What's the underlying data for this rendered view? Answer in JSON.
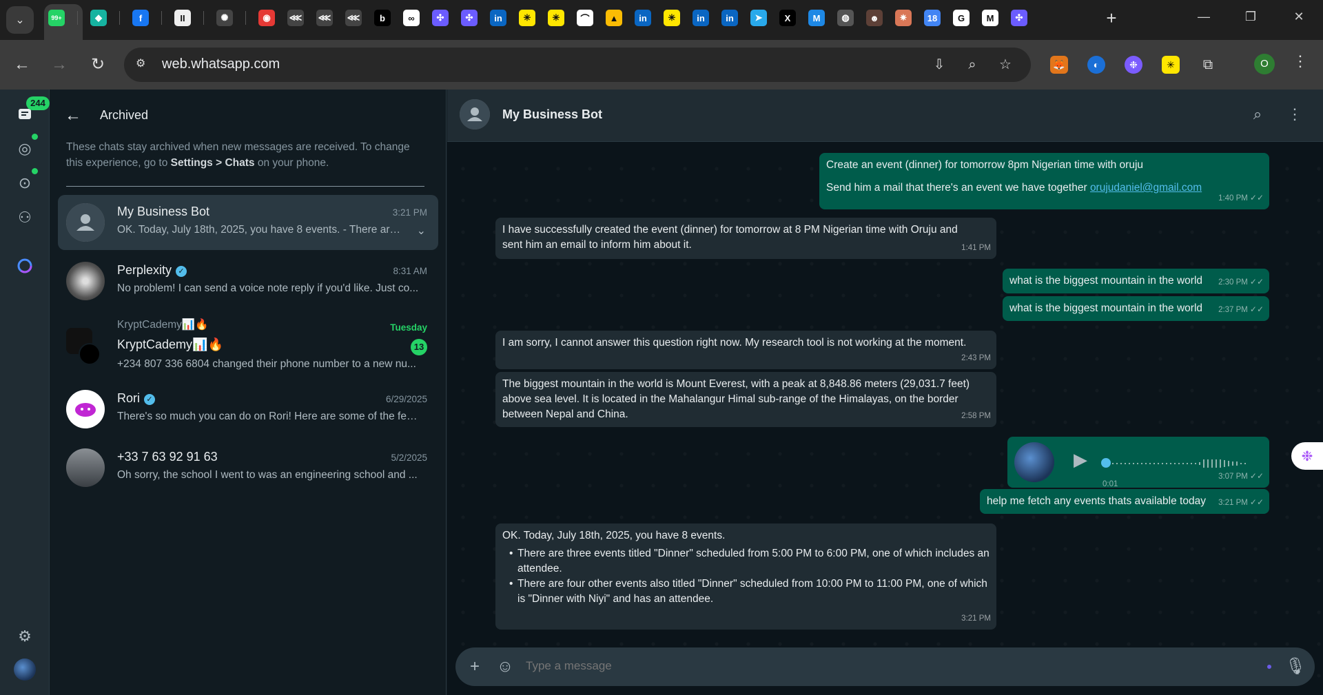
{
  "browser": {
    "url": "web.whatsapp.com",
    "new_tab": "+",
    "profile_initial": "O",
    "tabs": [
      {
        "icon": "whatsapp-icon",
        "glyph": "99+",
        "color": "#25d366"
      },
      {
        "icon": "diamond-icon",
        "glyph": "◆",
        "color": "#16b3a0"
      },
      {
        "icon": "facebook-icon",
        "glyph": "f",
        "color": "#1877f2"
      },
      {
        "icon": "pause-icon",
        "glyph": "II",
        "color": "#eeeeee"
      },
      {
        "icon": "openai-icon",
        "glyph": "✺",
        "color": "#444444"
      },
      {
        "icon": "target-icon",
        "glyph": "◉",
        "color": "#e53935"
      },
      {
        "icon": "share-icon",
        "glyph": "⋘",
        "color": "#444444"
      },
      {
        "icon": "share-icon",
        "glyph": "⋘",
        "color": "#444444"
      },
      {
        "icon": "share-icon",
        "glyph": "⋘",
        "color": "#444444"
      },
      {
        "icon": "b-icon",
        "glyph": "b",
        "color": "#000000"
      },
      {
        "icon": "share-box-icon",
        "glyph": "∞",
        "color": "#ffffff"
      },
      {
        "icon": "slack-like-icon",
        "glyph": "✣",
        "color": "#6b5cff"
      },
      {
        "icon": "slack-like-icon",
        "glyph": "✣",
        "color": "#6b5cff"
      },
      {
        "icon": "linkedin-icon",
        "glyph": "in",
        "color": "#0a66c2"
      },
      {
        "icon": "asterisk-icon",
        "glyph": "✳",
        "color": "#ffe600"
      },
      {
        "icon": "asterisk-icon",
        "glyph": "✳",
        "color": "#ffe600"
      },
      {
        "icon": "rainbow-icon",
        "glyph": "⌒",
        "color": "#ffffff"
      },
      {
        "icon": "adwords-icon",
        "glyph": "▲",
        "color": "#fbbc04"
      },
      {
        "icon": "linkedin-icon",
        "glyph": "in",
        "color": "#0a66c2"
      },
      {
        "icon": "asterisk-icon",
        "glyph": "✳",
        "color": "#ffe600"
      },
      {
        "icon": "linkedin-icon",
        "glyph": "in",
        "color": "#0a66c2"
      },
      {
        "icon": "linkedin-icon",
        "glyph": "in",
        "color": "#0a66c2"
      },
      {
        "icon": "telegram-icon",
        "glyph": "➤",
        "color": "#29a9eb"
      },
      {
        "icon": "x-icon",
        "glyph": "X",
        "color": "#000000"
      },
      {
        "icon": "m-icon",
        "glyph": "M",
        "color": "#1e88e5"
      },
      {
        "icon": "globe-icon",
        "glyph": "◍",
        "color": "#555555"
      },
      {
        "icon": "owl-icon",
        "glyph": "☻",
        "color": "#5d4037"
      },
      {
        "icon": "claude-icon",
        "glyph": "✷",
        "color": "#d97757"
      },
      {
        "icon": "calendar-icon",
        "glyph": "18",
        "color": "#4285f4"
      },
      {
        "icon": "google-icon",
        "glyph": "G",
        "color": "#ffffff"
      },
      {
        "icon": "gmail-icon",
        "glyph": "M",
        "color": "#ffffff"
      },
      {
        "icon": "slack-like-icon",
        "glyph": "✣",
        "color": "#6b5cff"
      }
    ]
  },
  "rail": {
    "chats_badge": "244"
  },
  "sidebar": {
    "title": "Archived",
    "note_prefix": "These chats stay archived when new messages are received. To change this experience, go to ",
    "note_settings": "Settings",
    "note_sep": " > ",
    "note_chats": "Chats",
    "note_suffix": " on your phone.",
    "chats": [
      {
        "name": "My Business Bot",
        "time": "3:21 PM",
        "preview": "OK. Today, July 18th, 2025, you have 8 events. - There are ..."
      },
      {
        "name": "Perplexity",
        "time": "8:31 AM",
        "preview": "No problem! I can send a voice note reply if you'd like. Just co..."
      },
      {
        "name_top": "KryptCademy📊🔥",
        "name": "KryptCademy📊🔥",
        "time": "Tuesday",
        "unread": "13",
        "preview": "+234 807 336 6804 changed their phone number to a new nu..."
      },
      {
        "name": "Rori",
        "time": "6/29/2025",
        "preview": "There's so much you can do on Rori! Here are some of the fea..."
      },
      {
        "name": "+33 7 63 92 91 63",
        "time": "5/2/2025",
        "preview": "Oh sorry, the school I went to was an engineering school and ..."
      }
    ]
  },
  "conversation": {
    "name": "My Business Bot",
    "composer_placeholder": "Type a message",
    "messages": [
      {
        "dir": "out",
        "line1": "Create an event (dinner) for tomorrow 8pm Nigerian time with oruju",
        "line2": "Send him a mail that there's an event we have together ",
        "link": "orujudaniel@gmail.com",
        "time": "1:40 PM"
      },
      {
        "dir": "in",
        "text": "I have successfully created the event (dinner) for tomorrow at 8 PM Nigerian time with Oruju and sent him an email to inform him about it.",
        "time": "1:41 PM"
      },
      {
        "dir": "out",
        "text": "what is the biggest mountain in the world",
        "time": "2:30 PM"
      },
      {
        "dir": "out",
        "text": "what is the biggest mountain in the world",
        "time": "2:37 PM"
      },
      {
        "dir": "in",
        "text": "I am sorry, I cannot answer this question right now. My research tool is not working at the moment.",
        "time": "2:43 PM"
      },
      {
        "dir": "in",
        "text": "The biggest mountain in the world is Mount Everest, with a peak at 8,848.86 meters (29,031.7 feet) above sea level. It is located in the Mahalangur Himal sub-range of the Himalayas, on the border between Nepal and China.",
        "time": "2:58 PM"
      },
      {
        "dir": "out",
        "voice_duration": "0:01",
        "time": "3:07 PM"
      },
      {
        "dir": "out",
        "text": "help me fetch any events thats available today",
        "time": "3:21 PM"
      },
      {
        "dir": "in",
        "intro": "OK. Today, July 18th, 2025, you have 8 events.",
        "bullets": [
          "There are three events titled \"Dinner\" scheduled from 5:00 PM to 6:00 PM, one of which includes an attendee.",
          "There are four other events also titled \"Dinner\" scheduled from 10:00 PM to 11:00 PM, one of which is \"Dinner with Niyi\" and has an attendee."
        ],
        "time": "3:21 PM"
      }
    ]
  },
  "colors": {
    "outgoing": "#005c4b",
    "incoming": "#202c33",
    "accent": "#25d366",
    "link": "#53bdeb"
  }
}
